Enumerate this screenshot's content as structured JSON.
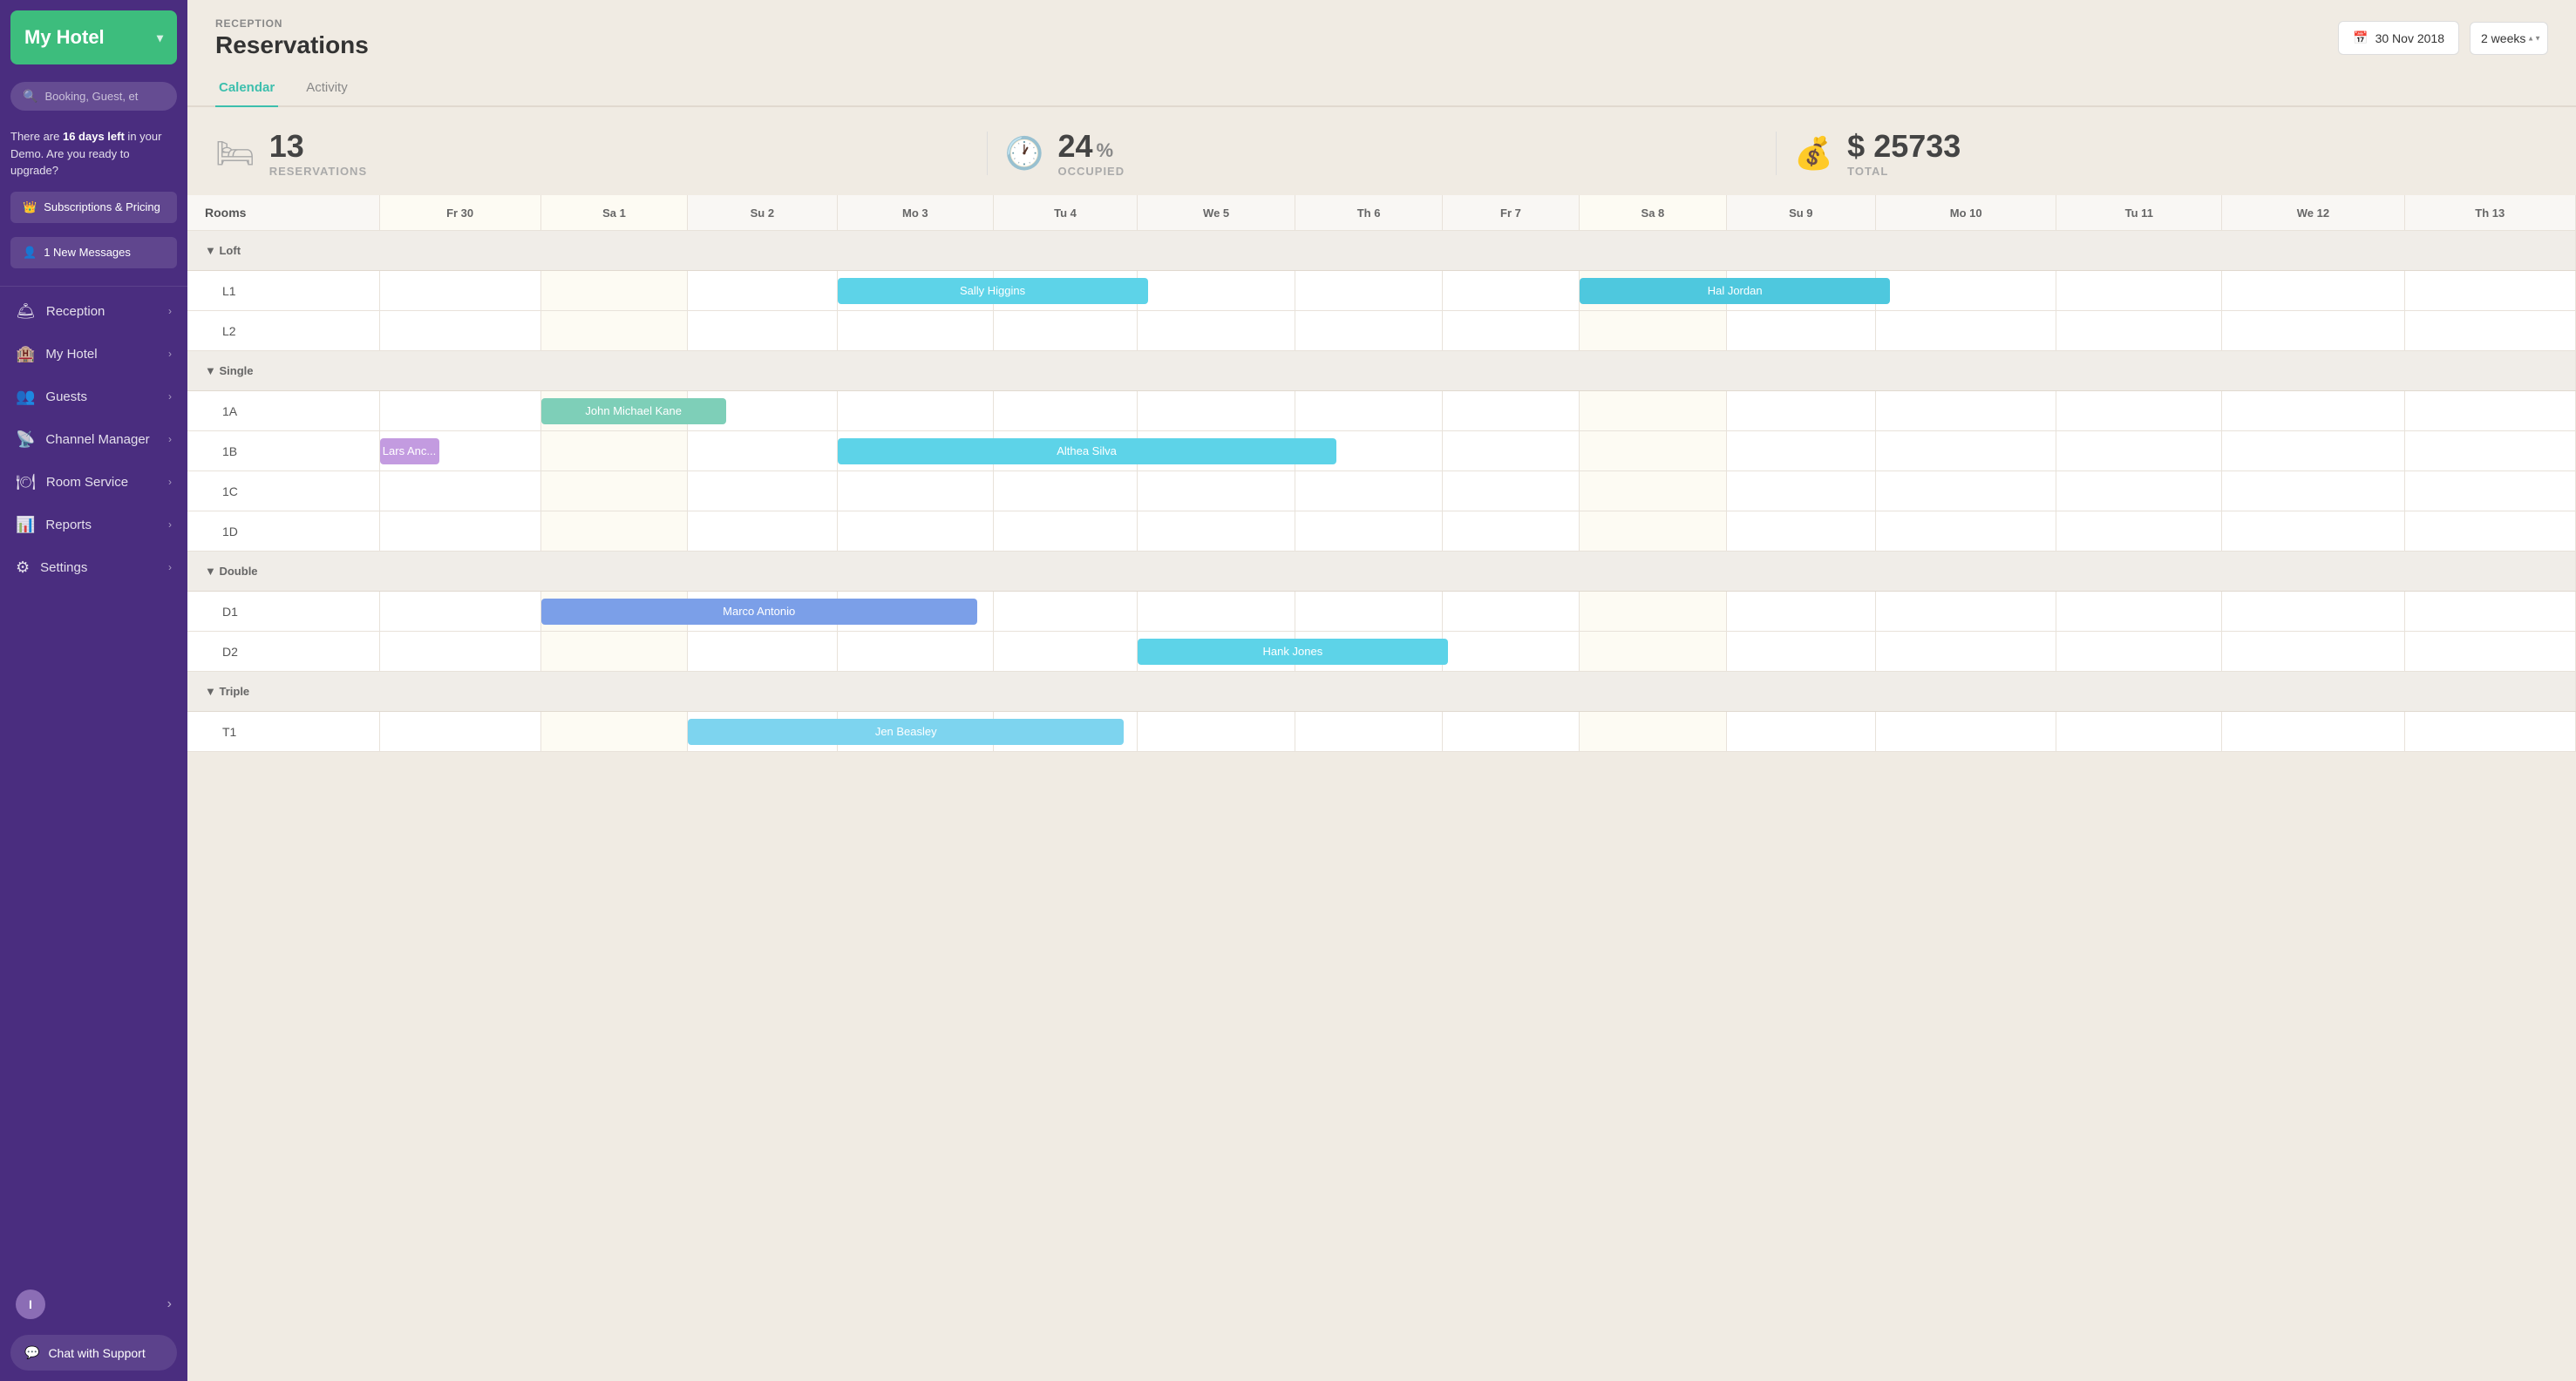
{
  "sidebar": {
    "hotel_name": "My Hotel",
    "search_placeholder": "Booking, Guest, et",
    "demo_banner": "There are 16 days left in your Demo. Are you ready to upgrade?",
    "demo_days": "16 days left",
    "upgrade_label": "Subscriptions & Pricing",
    "messages_label": "1 New Messages",
    "nav_items": [
      {
        "id": "reception",
        "label": "Reception",
        "icon": "🛎"
      },
      {
        "id": "my-hotel",
        "label": "My Hotel",
        "icon": "🏨"
      },
      {
        "id": "guests",
        "label": "Guests",
        "icon": "👥"
      },
      {
        "id": "channel-manager",
        "label": "Channel Manager",
        "icon": "📡"
      },
      {
        "id": "room-service",
        "label": "Room Service",
        "icon": "🍽"
      },
      {
        "id": "reports",
        "label": "Reports",
        "icon": "📊"
      },
      {
        "id": "settings",
        "label": "Settings",
        "icon": "⚙"
      }
    ],
    "user_initial": "I",
    "chat_support_label": "Chat with Support"
  },
  "header": {
    "section_label": "RECEPTION",
    "page_title": "Reservations",
    "date_value": "30 Nov 2018",
    "weeks_value": "2 weeks"
  },
  "tabs": [
    {
      "id": "calendar",
      "label": "Calendar",
      "active": true
    },
    {
      "id": "activity",
      "label": "Activity",
      "active": false
    }
  ],
  "stats": {
    "reservations_count": "13",
    "reservations_label": "RESERVATIONS",
    "occupied_pct": "24",
    "occupied_label": "OCCUPIED",
    "total_amount": "$ 25733",
    "total_label": "TOTAL"
  },
  "calendar": {
    "rooms_header": "Rooms",
    "columns": [
      "Fr 30",
      "Sa 1",
      "Su 2",
      "Mo 3",
      "Tu 4",
      "We 5",
      "Th 6",
      "Fr 7",
      "Sa 8",
      "Su 9",
      "Mo 10",
      "Tu 11",
      "We 12",
      "Th 13"
    ],
    "categories": [
      {
        "name": "Loft",
        "rooms": [
          {
            "id": "L1",
            "reservations": [
              {
                "name": "Sally Higgins",
                "color": "res-cyan",
                "startCol": 4,
                "span": 5
              },
              {
                "name": "Hal Jordan",
                "color": "res-cyan-dark",
                "startCol": 9,
                "span": 5
              }
            ]
          },
          {
            "id": "L2",
            "reservations": []
          }
        ]
      },
      {
        "name": "Single",
        "rooms": [
          {
            "id": "1A",
            "reservations": [
              {
                "name": "John Michael Kane",
                "color": "res-green",
                "startCol": 2,
                "span": 3
              }
            ]
          },
          {
            "id": "1B",
            "reservations": [
              {
                "name": "Lars Anc...",
                "color": "res-purple",
                "startCol": 1,
                "span": 1
              },
              {
                "name": "Althea Silva",
                "color": "res-cyan",
                "startCol": 4,
                "span": 8
              }
            ]
          },
          {
            "id": "1C",
            "reservations": []
          },
          {
            "id": "1D",
            "reservations": []
          }
        ]
      },
      {
        "name": "Double",
        "rooms": [
          {
            "id": "D1",
            "reservations": [
              {
                "name": "Marco Antonio",
                "color": "res-blue",
                "startCol": 2,
                "span": 7
              }
            ]
          },
          {
            "id": "D2",
            "reservations": [
              {
                "name": "Hank Jones",
                "color": "res-cyan",
                "startCol": 6,
                "span": 5
              }
            ]
          }
        ]
      },
      {
        "name": "Triple",
        "rooms": [
          {
            "id": "T1",
            "reservations": [
              {
                "name": "Jen Beasley",
                "color": "res-light-blue",
                "startCol": 3,
                "span": 7
              }
            ]
          }
        ]
      }
    ]
  }
}
